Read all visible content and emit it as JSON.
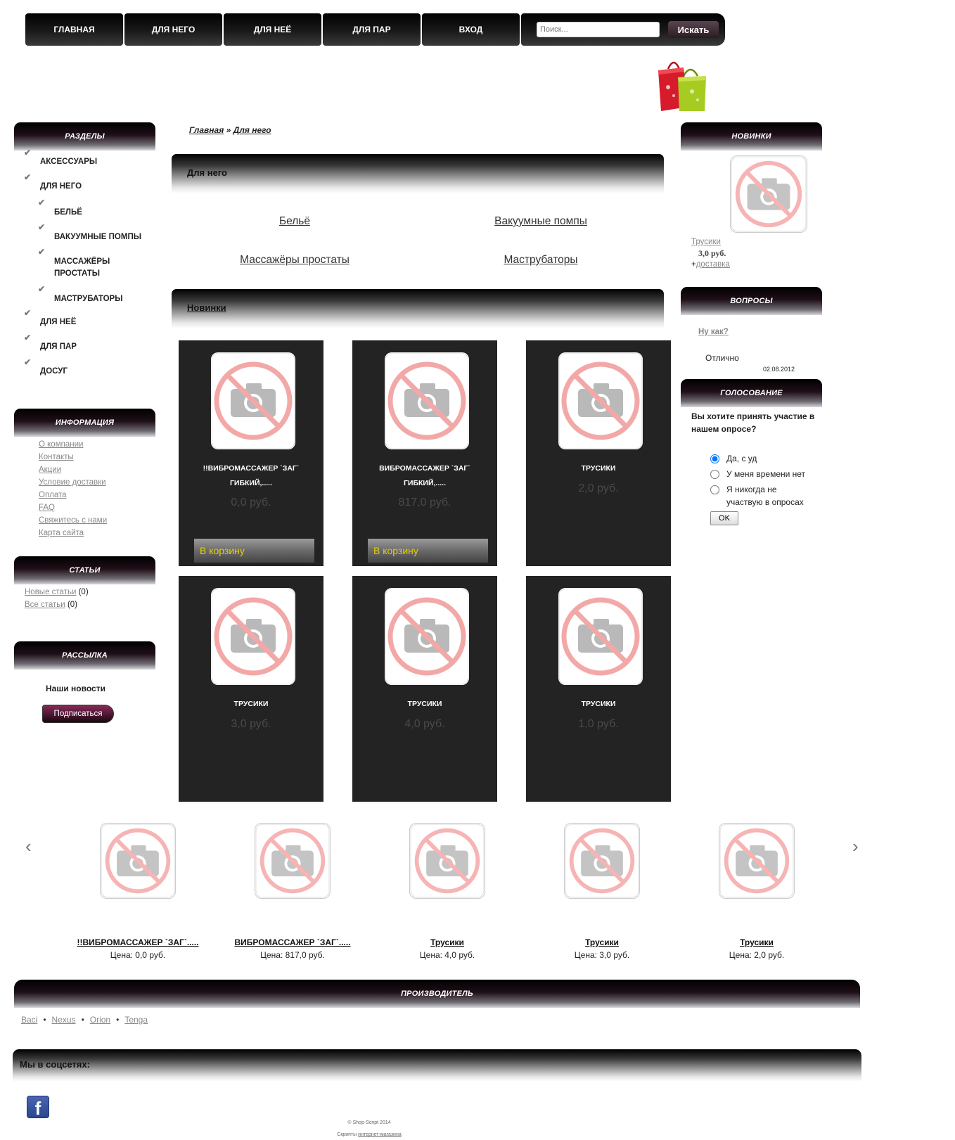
{
  "nav": {
    "items": [
      "Главная",
      "Для него",
      "Для неё",
      "Для пар",
      "Вход"
    ],
    "search_placeholder": "Поиск...",
    "search_button": "Искать"
  },
  "left": {
    "sections_title": "Разделы",
    "categories": [
      {
        "label": "Аксессуары",
        "level": 1
      },
      {
        "label": "Для него",
        "level": 1
      },
      {
        "label": "Бельё",
        "level": 2
      },
      {
        "label": "Вакуумные помпы",
        "level": 2
      },
      {
        "label": "Массажёры простаты",
        "level": 2
      },
      {
        "label": "Маструбаторы",
        "level": 2
      },
      {
        "label": "Для неё",
        "level": 1
      },
      {
        "label": "Для пар",
        "level": 1
      },
      {
        "label": "Досуг",
        "level": 1
      }
    ],
    "info_title": "Информация",
    "info_links": [
      "О компании",
      "Контакты",
      "Акции",
      "Условие доставки",
      "Оплата",
      "FAQ",
      "Свяжитесь с нами",
      "Карта сайта"
    ],
    "articles_title": "Статьи",
    "articles": [
      {
        "label": "Новые статьи",
        "count": "(0)"
      },
      {
        "label": "Все статьи",
        "count": "(0)"
      }
    ],
    "newsletter_title": "Рассылка",
    "newsletter_text": "Наши новости",
    "subscribe_button": "Подписаться"
  },
  "center": {
    "breadcrumb": {
      "home": "Главная",
      "sep": "»",
      "current": "Для него"
    },
    "heading": "Для него",
    "subcategories": [
      "Бельё",
      "Вакуумные помпы",
      "Массажёры простаты",
      "Маструбаторы"
    ],
    "new_heading": "Новинки",
    "products": [
      {
        "name": "!!ВИБРОМАССАЖЕР `ЗАГ` ГИБКИЙ,.....",
        "price": "0,0 руб.",
        "cart": "В корзину"
      },
      {
        "name": "ВИБРОМАССАЖЕР `ЗАГ` ГИБКИЙ,.....",
        "price": "817,0 руб.",
        "cart": "В корзину"
      },
      {
        "name": "ТРУСИКИ",
        "price": "2,0 руб.",
        "cart": ""
      },
      {
        "name": "ТРУСИКИ",
        "price": "3,0 руб.",
        "cart": ""
      },
      {
        "name": "ТРУСИКИ",
        "price": "4,0 руб.",
        "cart": ""
      },
      {
        "name": "ТРУСИКИ",
        "price": "1,0 руб.",
        "cart": ""
      }
    ]
  },
  "right": {
    "new_title": "Новинки",
    "new_item": {
      "name": "Трусики",
      "price": "3,0 руб.",
      "plus": "+",
      "delivery": "доставка"
    },
    "questions_title": "Вопросы",
    "question_link": "Ну как?",
    "answer": "Отлично",
    "answer_date": "02.08.2012",
    "poll_title": "Голосование",
    "poll_question": "Вы хотите принять участие в нашем опросе?",
    "poll_options": [
      "Да, с уд",
      "У меня времени нет",
      "Я никогда не участвую в опросах"
    ],
    "poll_selected": 0,
    "poll_button": "OK"
  },
  "carousel": {
    "items": [
      {
        "name": "!!ВИБРОМАССАЖЕР `ЗАГ`.....",
        "price": "Цена: 0,0 руб."
      },
      {
        "name": "ВИБРОМАССАЖЕР `ЗАГ`.....",
        "price": "Цена: 817,0 руб."
      },
      {
        "name": "Трусики",
        "price": "Цена: 4,0 руб."
      },
      {
        "name": "Трусики",
        "price": "Цена: 3,0 руб."
      },
      {
        "name": "Трусики",
        "price": "Цена: 2,0 руб."
      }
    ]
  },
  "manufacturer": {
    "title": "Производитель",
    "brands": [
      "Baci",
      "Nexus",
      "Orion",
      "Tenga"
    ]
  },
  "social": {
    "title": "Мы в соцсетях:",
    "facebook": "f"
  },
  "footer": {
    "copyright": "© Shop-Script 2014",
    "scripts_prefix": "Скрипты",
    "scripts_link": "интернет-магазина"
  },
  "colors": {
    "header_dark": "#000000",
    "card_bg": "#232323",
    "cart_text": "#e6d000",
    "muted_link": "#888888"
  }
}
